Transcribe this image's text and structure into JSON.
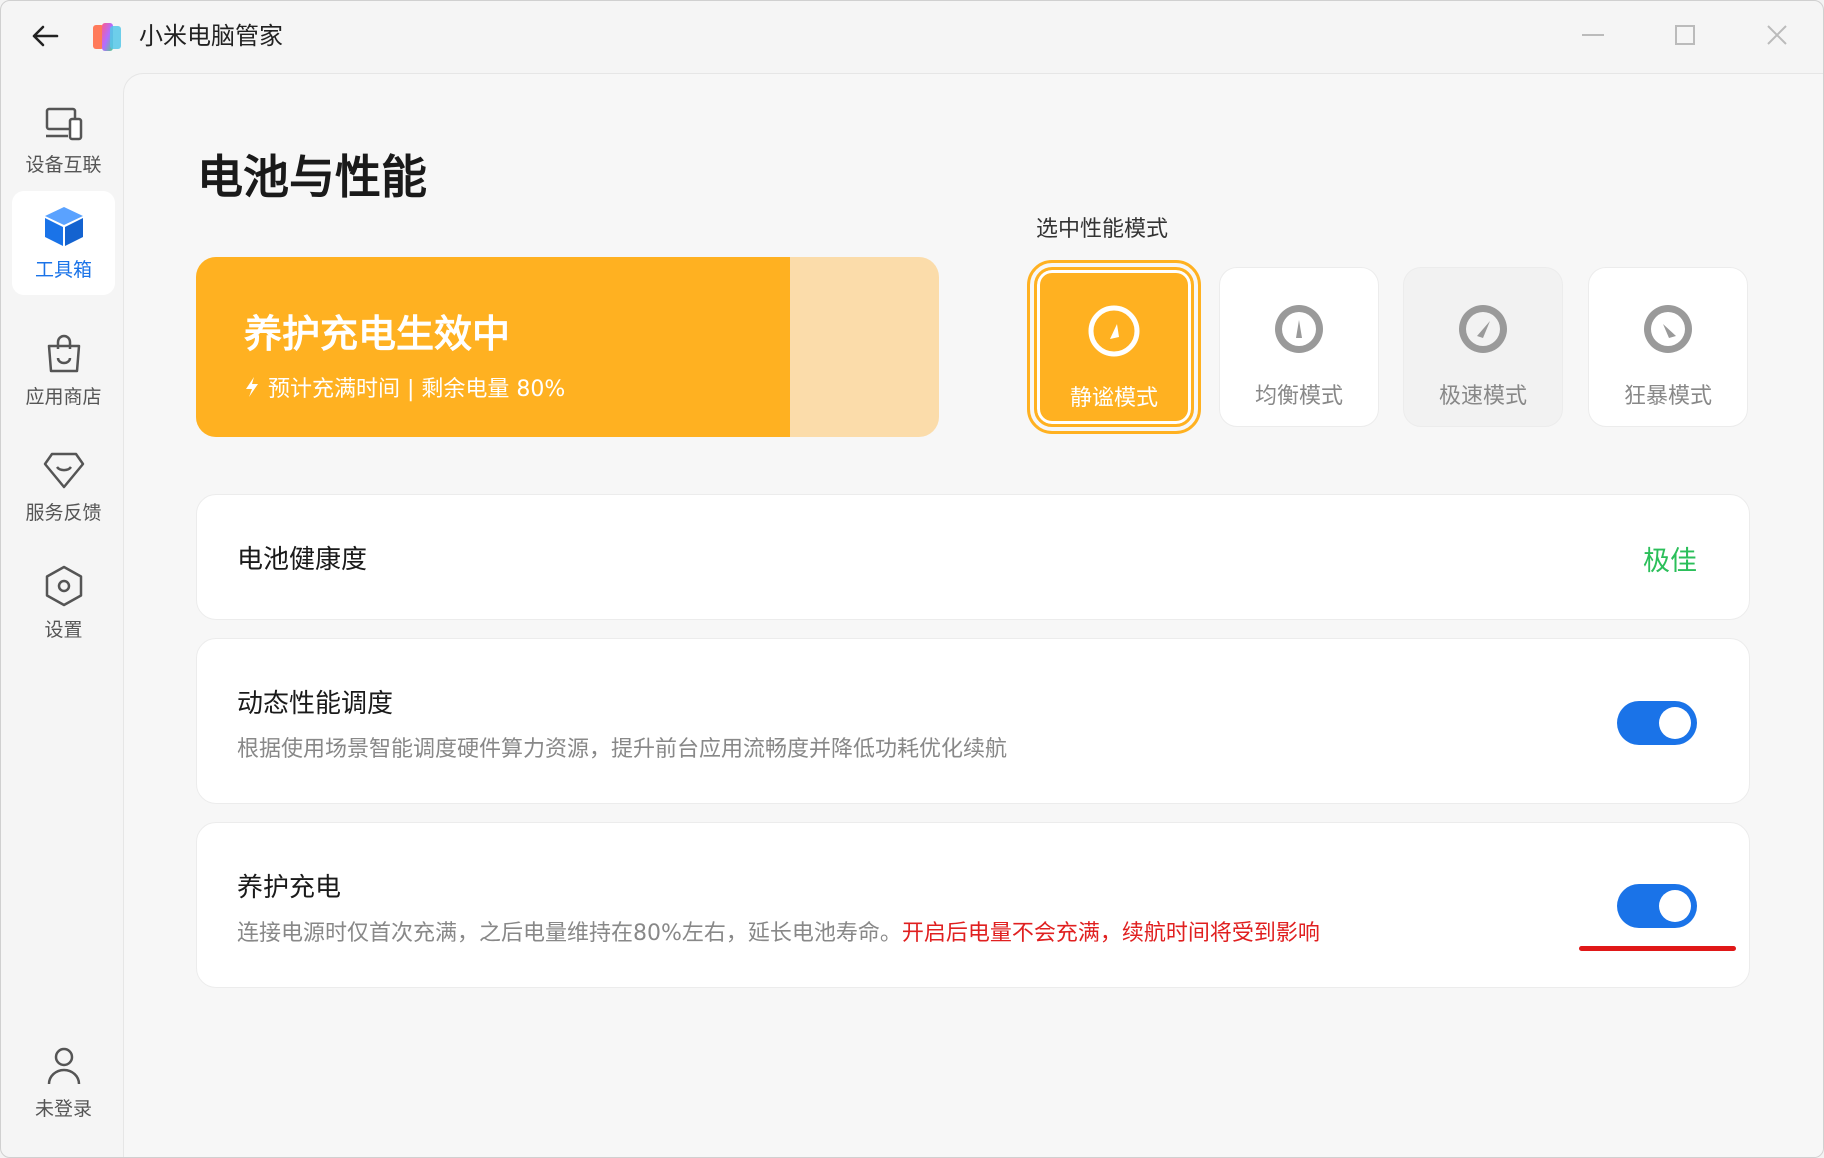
{
  "app": {
    "title": "小米电脑管家"
  },
  "sidebar": {
    "items": [
      {
        "label": "设备互联",
        "icon": "device-connect-icon",
        "active": false
      },
      {
        "label": "工具箱",
        "icon": "toolbox-cube-icon",
        "active": true
      },
      {
        "label": "应用商店",
        "icon": "shopping-bag-icon",
        "active": false
      },
      {
        "label": "服务反馈",
        "icon": "service-feedback-icon",
        "active": false
      },
      {
        "label": "设置",
        "icon": "settings-hexagon-icon",
        "active": false
      }
    ],
    "account": {
      "label": "未登录",
      "icon": "user-icon"
    }
  },
  "page": {
    "title": "电池与性能"
  },
  "charging_banner": {
    "headline": "养护充电生效中",
    "status": "预计充满时间 | 剩余电量 80%",
    "battery_level": 0.8,
    "colors": {
      "fill": "#ffb121",
      "rest": "#fbdcaa"
    }
  },
  "performance": {
    "label": "选中性能模式",
    "modes": [
      {
        "name": "静谧模式",
        "selected": true
      },
      {
        "name": "均衡模式",
        "selected": false
      },
      {
        "name": "极速模式",
        "selected": false
      },
      {
        "name": "狂暴模式",
        "selected": false
      }
    ]
  },
  "battery_health": {
    "title": "电池健康度",
    "value": "极佳"
  },
  "dynamic_performance": {
    "title": "动态性能调度",
    "description": "根据使用场景智能调度硬件算力资源，提升前台应用流畅度并降低功耗优化续航",
    "enabled": true
  },
  "care_charging": {
    "title": "养护充电",
    "description": "连接电源时仅首次充满，之后电量维持在80%左右，延长电池寿命。",
    "warning": "开启后电量不会充满，续航时间将受到影响",
    "enabled": true
  },
  "colors": {
    "accent": "#1a73e8",
    "warning": "#e02020",
    "good": "#2bbf5a",
    "orange": "#ffb121"
  }
}
